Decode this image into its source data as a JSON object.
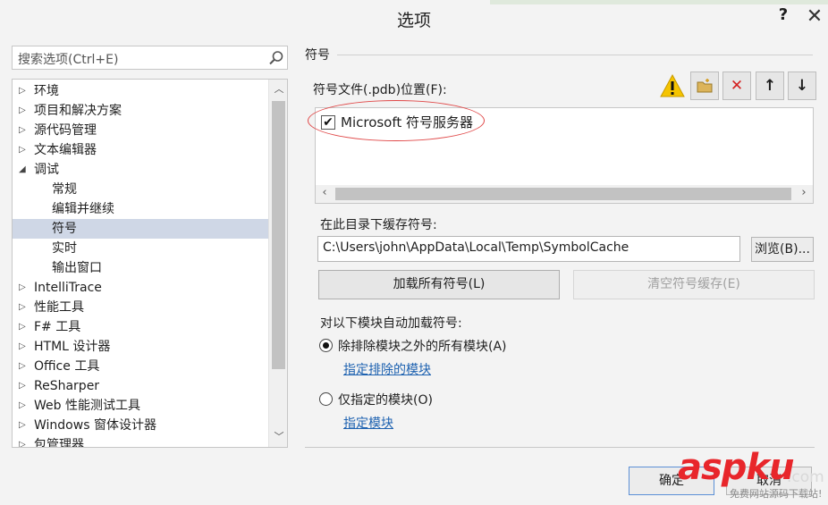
{
  "window": {
    "title": "选项",
    "help": "?",
    "close": "✕"
  },
  "search": {
    "placeholder": "搜索选项(Ctrl+E)"
  },
  "tree": {
    "items": [
      {
        "label": "环境",
        "arrow": "▷",
        "level": 0,
        "selected": false
      },
      {
        "label": "项目和解决方案",
        "arrow": "▷",
        "level": 0,
        "selected": false
      },
      {
        "label": "源代码管理",
        "arrow": "▷",
        "level": 0,
        "selected": false
      },
      {
        "label": "文本编辑器",
        "arrow": "▷",
        "level": 0,
        "selected": false
      },
      {
        "label": "调试",
        "arrow": "◢",
        "level": 0,
        "selected": false
      },
      {
        "label": "常规",
        "arrow": "",
        "level": 1,
        "selected": false
      },
      {
        "label": "编辑并继续",
        "arrow": "",
        "level": 1,
        "selected": false
      },
      {
        "label": "符号",
        "arrow": "",
        "level": 1,
        "selected": true
      },
      {
        "label": "实时",
        "arrow": "",
        "level": 1,
        "selected": false
      },
      {
        "label": "输出窗口",
        "arrow": "",
        "level": 1,
        "selected": false
      },
      {
        "label": "IntelliTrace",
        "arrow": "▷",
        "level": 0,
        "selected": false
      },
      {
        "label": "性能工具",
        "arrow": "▷",
        "level": 0,
        "selected": false
      },
      {
        "label": "F# 工具",
        "arrow": "▷",
        "level": 0,
        "selected": false
      },
      {
        "label": "HTML 设计器",
        "arrow": "▷",
        "level": 0,
        "selected": false
      },
      {
        "label": "Office 工具",
        "arrow": "▷",
        "level": 0,
        "selected": false
      },
      {
        "label": "ReSharper",
        "arrow": "▷",
        "level": 0,
        "selected": false
      },
      {
        "label": "Web 性能测试工具",
        "arrow": "▷",
        "level": 0,
        "selected": false
      },
      {
        "label": "Windows 窗体设计器",
        "arrow": "▷",
        "level": 0,
        "selected": false
      },
      {
        "label": "包管理器",
        "arrow": "▷",
        "level": 0,
        "selected": false
      }
    ]
  },
  "panel": {
    "section_title": "符号",
    "sym_file_label": "符号文件(.pdb)位置(F):",
    "toolbar": {
      "warning_icon": "warning-icon",
      "folder_icon": "folder-icon",
      "delete_glyph": "✕",
      "up_glyph": "↑",
      "down_glyph": "↓"
    },
    "symbol_servers": [
      {
        "label": "Microsoft 符号服务器",
        "checked": true
      }
    ],
    "cache_label": "在此目录下缓存符号:",
    "cache_path": "C:\\Users\\john\\AppData\\Local\\Temp\\SymbolCache",
    "browse_label": "浏览(B)...",
    "load_all_label": "加载所有符号(L)",
    "clear_cache_label": "清空符号缓存(E)",
    "auto_load_label": "对以下模块自动加载符号:",
    "radio_all": {
      "label": "除排除模块之外的所有模块(A)",
      "checked": true
    },
    "link_excluded": "指定排除的模块",
    "radio_specified": {
      "label": "仅指定的模块(O)",
      "checked": false
    },
    "link_specified": "指定模块"
  },
  "footer": {
    "ok_label": "确定",
    "cancel_label": "取消"
  },
  "watermark": {
    "brand": "aspku",
    "suffix": ".com",
    "sub": "免费网站源码下载站!"
  },
  "colors": {
    "selection": "#cfd7e6",
    "link": "#1e62b0",
    "annotation": "#e04848",
    "warning": "#f5c400"
  }
}
